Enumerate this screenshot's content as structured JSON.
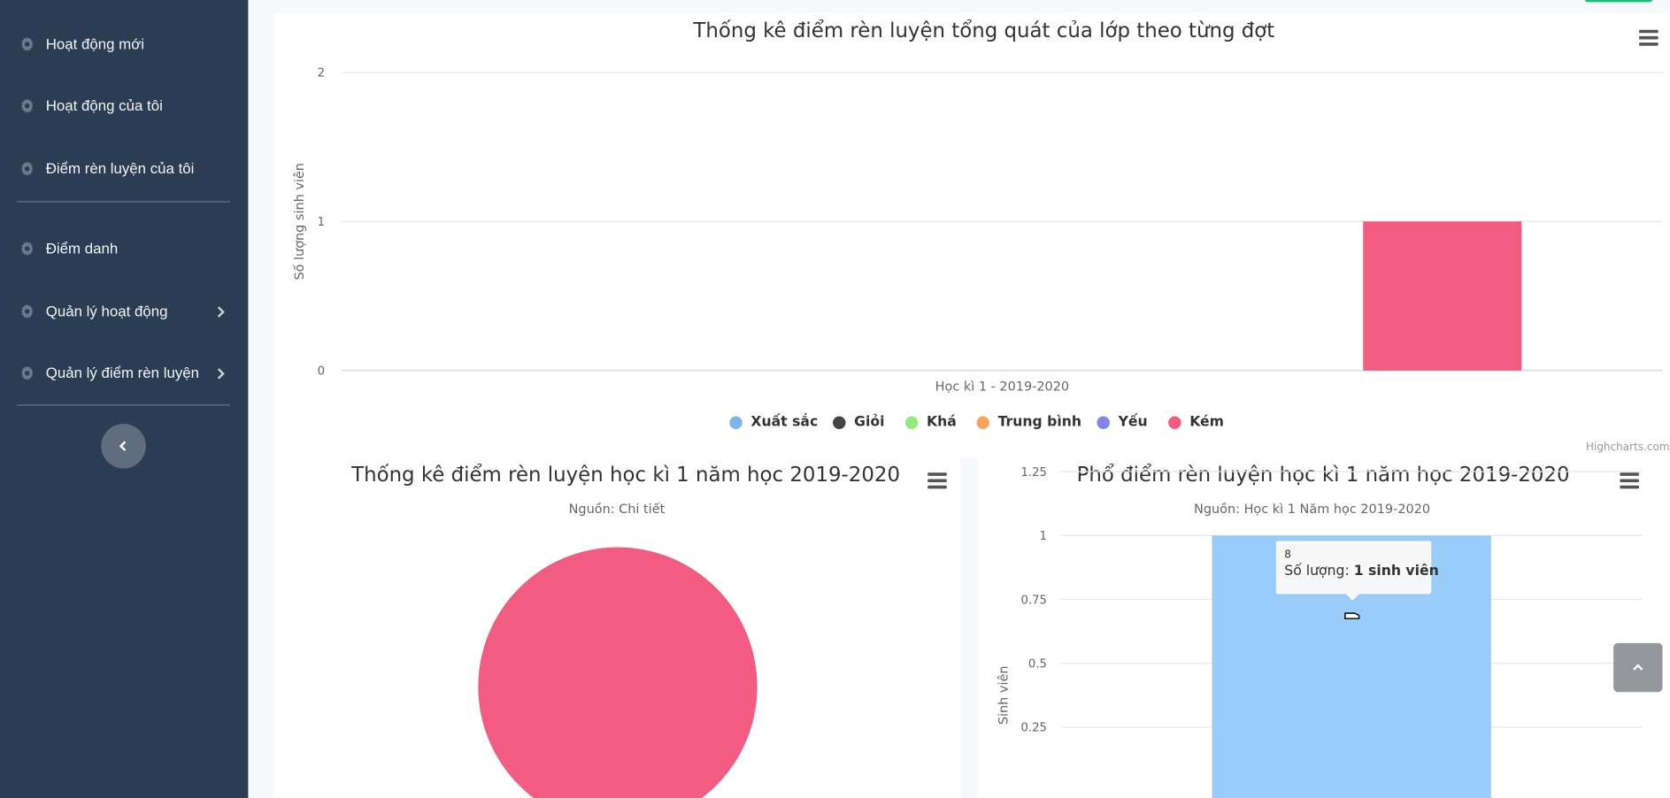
{
  "sidebar": {
    "items": [
      {
        "label": "Hoạt động mới",
        "icon": "gear-icon"
      },
      {
        "label": "Hoạt động của tôi",
        "icon": "gear-icon"
      },
      {
        "label": "Điểm rèn luyện của tôi",
        "icon": "gear-icon"
      },
      {
        "label": "Điểm danh",
        "icon": "gear-icon"
      },
      {
        "label": "Quản lý hoạt động",
        "icon": "gear-icon",
        "has_submenu": true
      },
      {
        "label": "Quản lý điểm rèn luyện",
        "icon": "gear-icon",
        "has_submenu": true
      }
    ],
    "collapse_icon": "chevron-left-icon"
  },
  "colors": {
    "sidebar_bg": "#2b3d52",
    "xuat_sac": "#7cb5ec",
    "gioi": "#434348",
    "kha": "#90ed7d",
    "trung_binh": "#f7a35c",
    "yeu": "#8085e9",
    "kem": "#f15c80",
    "bar_light_blue": "#99ccfa"
  },
  "credits": "Highcharts.com",
  "tooltip": {
    "header": "8",
    "label": "Số lượng: ",
    "value": "1 sinh viên"
  },
  "chart_data": [
    {
      "type": "bar",
      "title": "Thống kê điểm rèn luyện tổng quát của lớp theo từng đợt",
      "ylabel": "Số lượng sinh viên",
      "xlabel": "",
      "categories": [
        "Học kì 1 - 2019-2020"
      ],
      "ylim": [
        0,
        2
      ],
      "yticks": [
        "0",
        "1",
        "2"
      ],
      "legend_position": "bottom-center",
      "series": [
        {
          "name": "Xuất sắc",
          "values": [
            0
          ]
        },
        {
          "name": "Giỏi",
          "values": [
            0
          ]
        },
        {
          "name": "Khá",
          "values": [
            0
          ]
        },
        {
          "name": "Trung bình",
          "values": [
            0
          ]
        },
        {
          "name": "Yếu",
          "values": [
            0
          ]
        },
        {
          "name": "Kém",
          "values": [
            1
          ]
        }
      ]
    },
    {
      "type": "pie",
      "title": "Thống kê điểm rèn luyện học kì 1 năm học 2019-2020",
      "subtitle": "Nguồn: Chi tiết",
      "slices": [
        {
          "name": "Kém",
          "value": 1
        }
      ]
    },
    {
      "type": "bar",
      "title": "Phổ điểm rèn luyện học kì 1 năm học 2019-2020",
      "subtitle": "Nguồn: Học kì 1 Năm học 2019-2020",
      "ylabel": "Sinh viên",
      "categories": [
        "8"
      ],
      "values": [
        1
      ],
      "yticks": [
        "0.25",
        "0.5",
        "0.75",
        "1",
        "1.25"
      ],
      "ylim": [
        0,
        1.25
      ]
    }
  ]
}
